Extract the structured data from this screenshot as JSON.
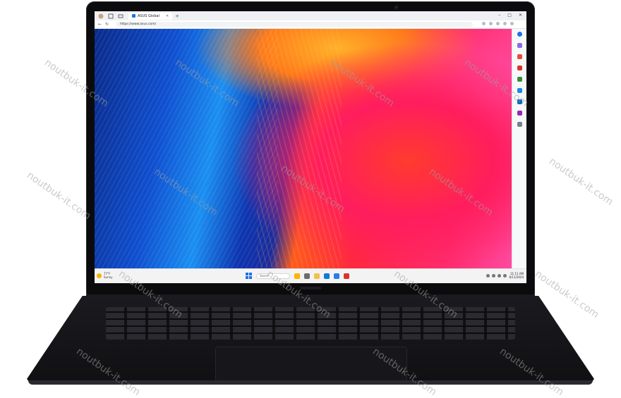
{
  "browser": {
    "tab_title": "ASUS Global",
    "url": "https://www.asus.com/"
  },
  "taskbar": {
    "weather_temp": "77°F",
    "weather_desc": "Sunny",
    "search_placeholder": "Search",
    "time": "11:11 AM",
    "date": "6/11/2024"
  },
  "watermark": "noutbuk-it.com"
}
